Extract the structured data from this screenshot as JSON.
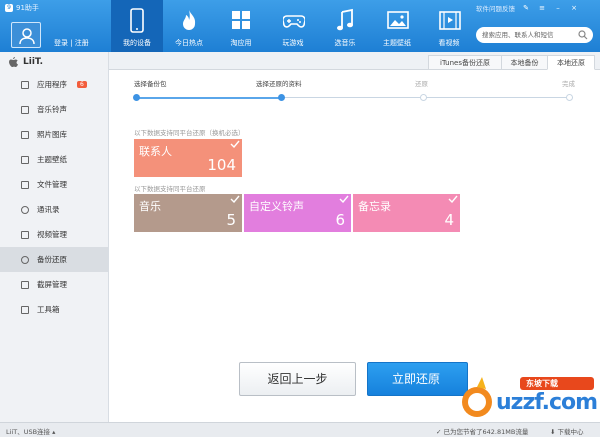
{
  "app": {
    "name": "91助手"
  },
  "header": {
    "user_links": "登录 | 注册",
    "nav": [
      {
        "label": "我的设备",
        "icon": "phone-icon",
        "active": true
      },
      {
        "label": "今日热点",
        "icon": "flame-icon"
      },
      {
        "label": "淘应用",
        "icon": "apps-grid-icon"
      },
      {
        "label": "玩游戏",
        "icon": "gamepad-icon"
      },
      {
        "label": "选音乐",
        "icon": "music-note-icon"
      },
      {
        "label": "主题壁纸",
        "icon": "picture-icon"
      },
      {
        "label": "看视频",
        "icon": "film-icon"
      }
    ],
    "feedback_link": "软件问题反馈",
    "search_placeholder": "搜索应用、联系人和短信"
  },
  "sidebar": {
    "brand": "LiiT.",
    "items": [
      {
        "label": "应用程序",
        "badge": "6"
      },
      {
        "label": "音乐铃声"
      },
      {
        "label": "照片图库"
      },
      {
        "label": "主题壁纸"
      },
      {
        "label": "文件管理"
      },
      {
        "label": "通讯录"
      },
      {
        "label": "视频管理"
      },
      {
        "label": "备份还原",
        "active": true
      },
      {
        "label": "截屏管理"
      },
      {
        "label": "工具箱"
      }
    ]
  },
  "tabs": [
    {
      "label": "iTunes备份还原"
    },
    {
      "label": "本地备份"
    },
    {
      "label": "本地还原",
      "active": true
    }
  ],
  "steps": [
    {
      "label": "选择备份包",
      "done": true
    },
    {
      "label": "选择还原的资料",
      "done": true
    },
    {
      "label": "还原",
      "done": false
    },
    {
      "label": "完成",
      "done": false
    }
  ],
  "sections": {
    "required_hint": "以下数据支持同平台还原（换机必选）",
    "same_platform_hint": "以下数据支持同平台还原"
  },
  "tiles": [
    {
      "name": "联系人",
      "count": "104",
      "color": "#f4917a"
    },
    {
      "name": "音乐",
      "count": "5",
      "color": "#b49a8c"
    },
    {
      "name": "自定义铃声",
      "count": "6",
      "color": "#e27ede"
    },
    {
      "name": "备忘录",
      "count": "4",
      "color": "#f48bb4"
    }
  ],
  "buttons": {
    "back": "返回上一步",
    "restore": "立即还原"
  },
  "watermark": {
    "text": "uzzf.com",
    "badge": "东坡下载"
  },
  "status": {
    "device": "LiiT、USB连接 ▴",
    "traffic": "已为您节省了642.81MB流量",
    "download": "下载中心"
  },
  "colors": {
    "header": "#2688db",
    "accent": "#3d93e4",
    "primary_button": "#1e8ee6"
  }
}
